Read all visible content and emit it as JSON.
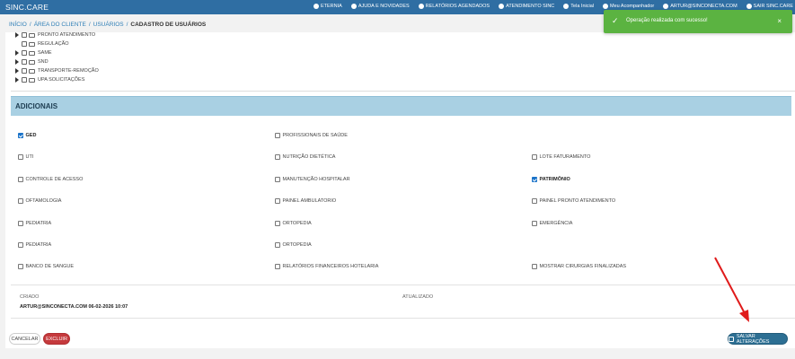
{
  "nav": {
    "brand": "SINC.CARE",
    "items": [
      {
        "label": "ETERNIA",
        "icon": "chat-icon"
      },
      {
        "label": "AJUDA E NOVIDADES",
        "icon": "help-icon"
      },
      {
        "label": "RELATÓRIOS AGENDADOS",
        "icon": "report-icon"
      },
      {
        "label": "ATENDIMENTO SINC",
        "icon": "question-icon"
      },
      {
        "label": "Tela Inicial",
        "icon": "home-icon"
      },
      {
        "label": "Meu Acompanhador",
        "icon": "edit-icon"
      },
      {
        "label": "ARTUR@SINCONECTA.COM",
        "icon": "user-icon"
      },
      {
        "label": "SAIR SINC.CARE",
        "icon": "logout-icon"
      }
    ]
  },
  "breadcrumb": {
    "home": "INÍCIO",
    "client_area": "ÁREA DO CLIENTE",
    "users": "USUÁRIOS",
    "current": "CADASTRO DE USUÁRIOS",
    "sep": "/"
  },
  "tree": [
    {
      "label": "PRONTO ATENDIMENTO",
      "expandable": true
    },
    {
      "label": "REGULAÇÃO",
      "expandable": false
    },
    {
      "label": "SAME",
      "expandable": true
    },
    {
      "label": "SND",
      "expandable": true
    },
    {
      "label": "TRANSPORTE-REMOÇÃO",
      "expandable": true
    },
    {
      "label": "UPA SOLICITAÇÕES",
      "expandable": true
    }
  ],
  "section": {
    "title": "ADICIONAIS"
  },
  "options": [
    {
      "label": "GED",
      "checked": true
    },
    {
      "label": "PROFISSIONAIS DE SAÚDE",
      "checked": false
    },
    {
      "label": "UTI",
      "checked": false
    },
    {
      "label": "NUTRIÇÃO DIETÉTICA",
      "checked": false
    },
    {
      "label": "LOTE FATURAMENTO",
      "checked": false
    },
    {
      "label": "CONTROLE DE ACESSO",
      "checked": false
    },
    {
      "label": "MANUTENÇÃO HOSPITALAR",
      "checked": false
    },
    {
      "label": "PATRIMÔNIO",
      "checked": true
    },
    {
      "label": "OFTAMOLOGIA",
      "checked": false
    },
    {
      "label": "PAINEL AMBULATORIO",
      "checked": false
    },
    {
      "label": "PAINEL PRONTO ATENDIMENTO",
      "checked": false
    },
    {
      "label": "PEDIATRIA",
      "checked": false
    },
    {
      "label": "ORTOPEDIA",
      "checked": false
    },
    {
      "label": "EMERGÊNCIA",
      "checked": false
    },
    {
      "label": "PEDIATRIA",
      "checked": false
    },
    {
      "label": "ORTOPEDIA",
      "checked": false
    },
    {
      "label": "BANCO DE SANGUE",
      "checked": false
    },
    {
      "label": "RELATÓRIOS FINANCEIROS HOTELARIA",
      "checked": false
    },
    {
      "label": "MOSTRAR CIRURGIAS FINALIZADAS",
      "checked": false
    }
  ],
  "meta": {
    "created_label": "CRIADO",
    "created_value": "ARTUR@SINCONECTA.COM 06-02-2026 10:07",
    "updated_label": "ATUALIZADO"
  },
  "buttons": {
    "cancel": "CANCELAR",
    "delete": "EXCLUIR",
    "save": "SALVAR ALTERAÇÕES"
  },
  "toast": {
    "message": "Operação realizada com sucesso!",
    "check": "✓",
    "close": "×"
  },
  "colors": {
    "navbar": "#2f6ea3",
    "section_header": "#a9d0e3",
    "toast": "#5bb341",
    "delete": "#c53a3d",
    "save": "#2d6f93",
    "arrow": "#e01b1b"
  }
}
